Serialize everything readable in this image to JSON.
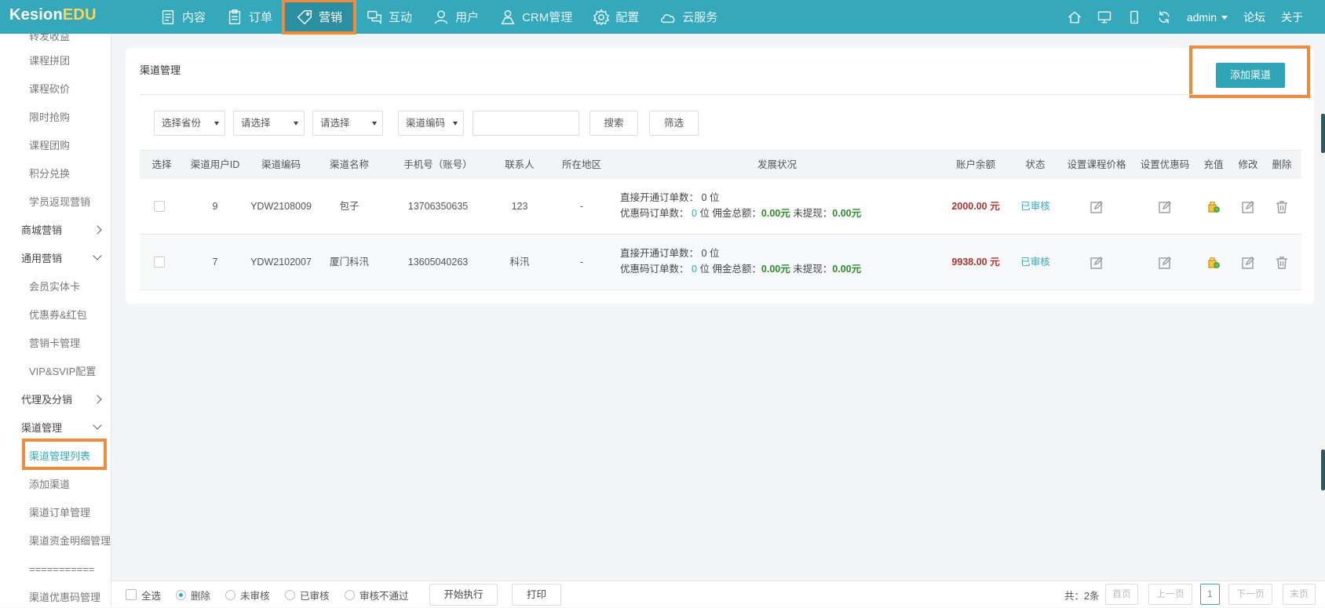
{
  "app": {
    "logo_a": "Kesion",
    "logo_b": "EDU"
  },
  "nav": [
    "内容",
    "订单",
    "营销",
    "互动",
    "用户",
    "CRM管理",
    "配置",
    "云服务"
  ],
  "topright": {
    "user": "admin",
    "forum": "论坛",
    "about": "关于"
  },
  "sidebar": {
    "top_cut": "转发收益",
    "items": [
      "课程拼团",
      "课程砍价",
      "限时抢购",
      "课程团购",
      "积分兑换",
      "学员返现营销"
    ],
    "group_mall": "商城营销",
    "group_general": "通用营销",
    "general_items": [
      "会员实体卡",
      "优惠券&红包",
      "营销卡管理",
      "VIP&SVIP配置"
    ],
    "group_agent": "代理及分销",
    "group_channel": "渠道管理",
    "channel_items": [
      "渠道管理列表",
      "添加渠道",
      "渠道订单管理",
      "渠道资金明细管理",
      "===========",
      "渠道优惠码管理"
    ]
  },
  "card": {
    "title": "渠道管理",
    "add_button": "添加渠道"
  },
  "filters": {
    "province": "选择省份",
    "select1": "请选择",
    "select2": "请选择",
    "code": "渠道编码",
    "search": "搜索",
    "filter": "筛选"
  },
  "table": {
    "headers": [
      "选择",
      "渠道用户ID",
      "渠道编码",
      "渠道名称",
      "手机号（账号）",
      "联系人",
      "所在地区",
      "发展状况",
      "账户余额",
      "状态",
      "设置课程价格",
      "设置优惠码",
      "充值",
      "修改",
      "删除"
    ],
    "rows": [
      {
        "id": "9",
        "code": "YDW2108009",
        "name": "包子",
        "phone": "13706350635",
        "contact": "123",
        "region": "-",
        "dev_line1_label": "直接开通订单数：",
        "dev_line1_value": "0 位",
        "dev_coupon_label": "优惠码订单数：",
        "dev_coupon_count": "0",
        "dev_coupon_unit": "位 佣金总额：",
        "dev_commission": "0.00元",
        "dev_unpaid_label": "未提现：",
        "dev_unpaid": "0.00元",
        "balance": "2000.00 元",
        "status": "已审核"
      },
      {
        "id": "7",
        "code": "YDW2102007",
        "name": "厦门科汛",
        "phone": "13605040263",
        "contact": "科汛",
        "region": "-",
        "dev_line1_label": "直接开通订单数：",
        "dev_line1_value": "0 位",
        "dev_coupon_label": "优惠码订单数：",
        "dev_coupon_count": "0",
        "dev_coupon_unit": "位 佣金总额：",
        "dev_commission": "0.00元",
        "dev_unpaid_label": "未提现：",
        "dev_unpaid": "0.00元",
        "balance": "9938.00 元",
        "status": "已审核"
      }
    ]
  },
  "bottom": {
    "select_all": "全选",
    "opt_delete": "删除",
    "opt_unreviewed": "未审核",
    "opt_reviewed": "已审核",
    "opt_rejected": "审核不通过",
    "execute": "开始执行",
    "print": "打印",
    "total": "共：2条",
    "first": "首页",
    "prev": "上一页",
    "page": "1",
    "next": "下一页",
    "last": "末页"
  }
}
